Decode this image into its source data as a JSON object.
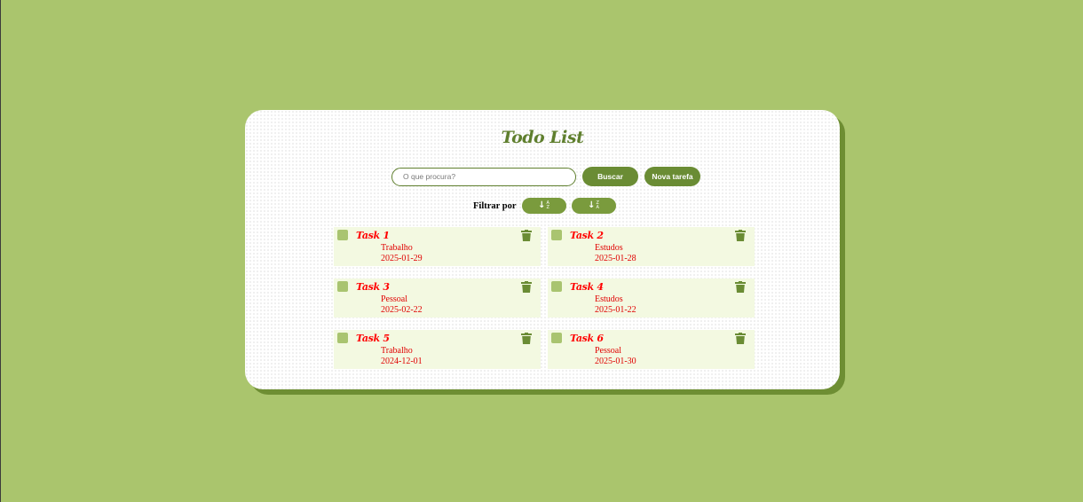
{
  "app": {
    "title": "Todo List"
  },
  "search": {
    "placeholder": "O que procura?",
    "value": ""
  },
  "buttons": {
    "search_label": "Buscar",
    "new_task_label": "Nova tarefa"
  },
  "filter": {
    "label": "Filtrar por",
    "sort_options": [
      {
        "icon": "sort-ascending-icon",
        "top": "A",
        "bottom": "Z"
      },
      {
        "icon": "sort-descending-icon",
        "top": "Z",
        "bottom": "A"
      }
    ]
  },
  "tasks": [
    {
      "title": "Task 1",
      "category": "Trabalho",
      "date": "2025-01-29"
    },
    {
      "title": "Task 2",
      "category": "Estudos",
      "date": "2025-01-28"
    },
    {
      "title": "Task 3",
      "category": "Pessoal",
      "date": "2025-02-22"
    },
    {
      "title": "Task 4",
      "category": "Estudos",
      "date": "2025-01-22"
    },
    {
      "title": "Task 5",
      "category": "Trabalho",
      "date": "2024-12-01"
    },
    {
      "title": "Task 6",
      "category": "Pessoal",
      "date": "2025-01-30"
    }
  ],
  "colors": {
    "background": "#aac56d",
    "accent": "#6a8c34",
    "task_text": "#ff0000",
    "task_bg": "#f3f9e1"
  }
}
